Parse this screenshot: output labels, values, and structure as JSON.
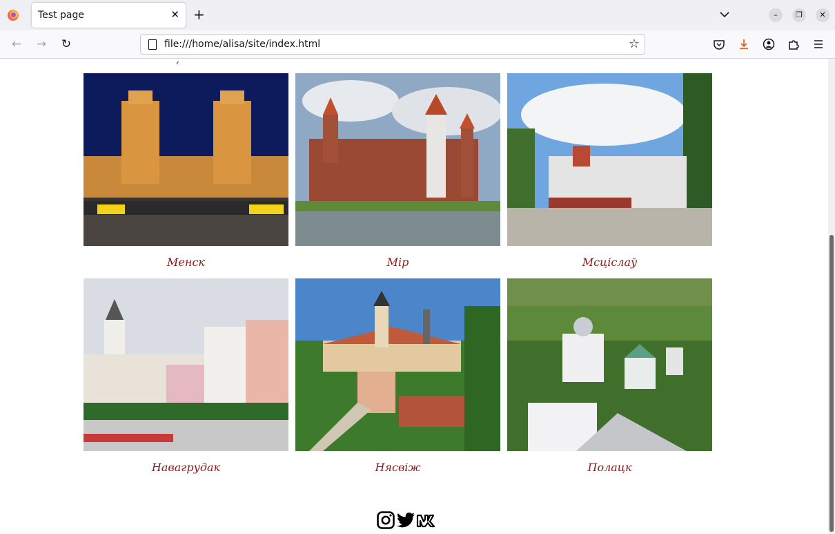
{
  "browser": {
    "tab_title": "Test page",
    "url": "file:///home/alisa/site/index.html"
  },
  "page": {
    "cities": [
      {
        "name": "Менск"
      },
      {
        "name": "Мір"
      },
      {
        "name": "Мсціслаў"
      },
      {
        "name": "Навагрудак"
      },
      {
        "name": "Нясвіж"
      },
      {
        "name": "Полацк"
      }
    ],
    "social": [
      "instagram-icon",
      "twitter-icon",
      "vk-icon"
    ],
    "caption_color": "#8b1a1a"
  }
}
